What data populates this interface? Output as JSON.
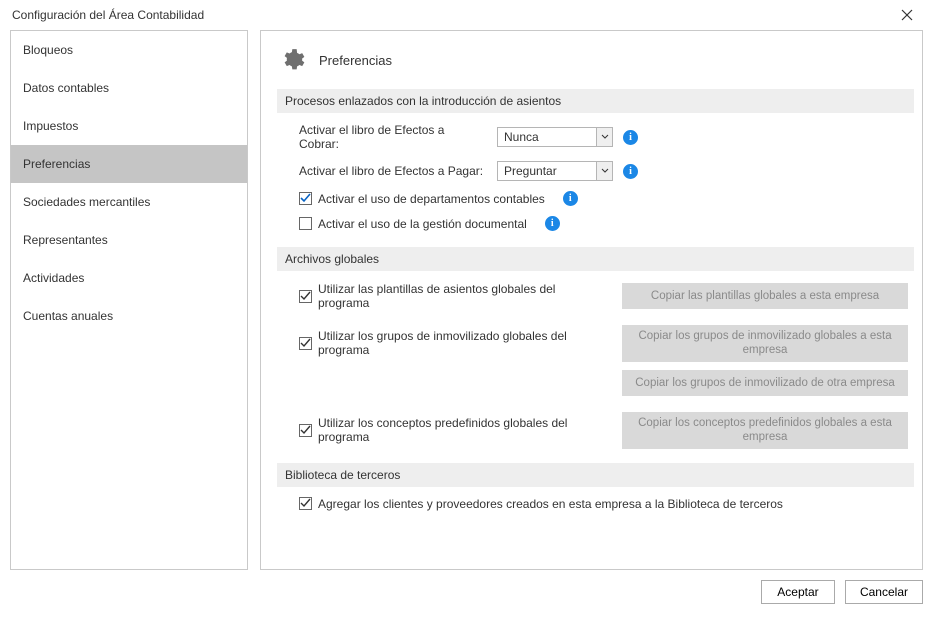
{
  "window": {
    "title": "Configuración del Área Contabilidad"
  },
  "sidebar": {
    "items": [
      {
        "label": "Bloqueos",
        "selected": false
      },
      {
        "label": "Datos contables",
        "selected": false
      },
      {
        "label": "Impuestos",
        "selected": false
      },
      {
        "label": "Preferencias",
        "selected": true
      },
      {
        "label": "Sociedades mercantiles",
        "selected": false
      },
      {
        "label": "Representantes",
        "selected": false
      },
      {
        "label": "Actividades",
        "selected": false
      },
      {
        "label": "Cuentas anuales",
        "selected": false
      }
    ]
  },
  "page": {
    "title": "Preferencias"
  },
  "sections": {
    "procesos": {
      "header": "Procesos enlazados con la introducción de asientos",
      "cobrar_label": "Activar el libro de Efectos a Cobrar:",
      "cobrar_value": "Nunca",
      "pagar_label": "Activar el libro de Efectos a Pagar:",
      "pagar_value": "Preguntar",
      "departamentos_label": "Activar el uso de departamentos contables",
      "departamentos_checked": true,
      "documental_label": "Activar el uso de la gestión documental",
      "documental_checked": false
    },
    "archivos": {
      "header": "Archivos globales",
      "plantillas_label": "Utilizar las plantillas de asientos globales del programa",
      "plantillas_btn": "Copiar las plantillas globales a esta empresa",
      "inmov_label": "Utilizar los grupos de inmovilizado globales del programa",
      "inmov_btn1": "Copiar los grupos de inmovilizado globales a esta empresa",
      "inmov_btn2": "Copiar los grupos de inmovilizado de otra empresa",
      "conceptos_label": "Utilizar los conceptos predefinidos globales del programa",
      "conceptos_btn": "Copiar los conceptos predefinidos globales a esta empresa"
    },
    "biblioteca": {
      "header": "Biblioteca de terceros",
      "agregar_label": "Agregar los clientes y proveedores creados en esta empresa a la Biblioteca de terceros"
    }
  },
  "footer": {
    "accept": "Aceptar",
    "cancel": "Cancelar"
  }
}
